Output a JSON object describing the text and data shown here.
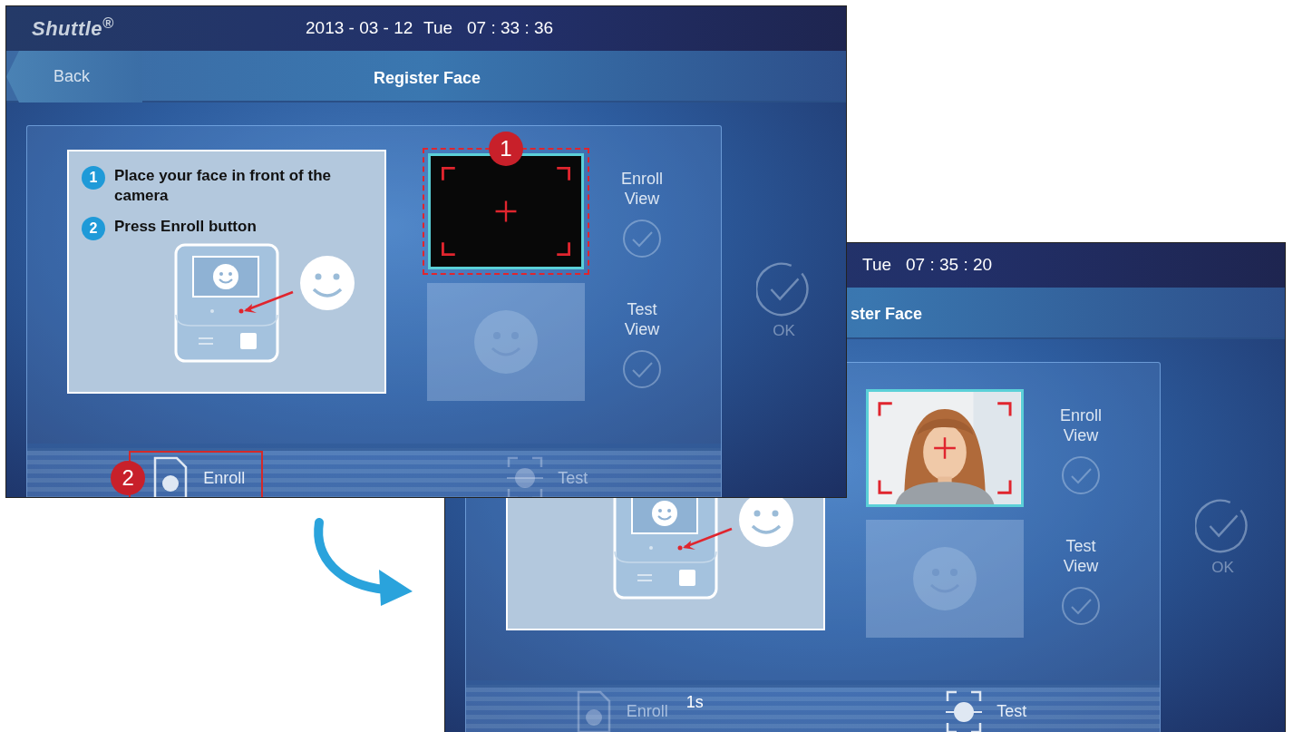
{
  "screens": [
    {
      "logo": "Shuttle$^{®}$",
      "status": {
        "date": "2013 - 03 - 12",
        "day": "Tue",
        "time": "07 : 33 : 36"
      },
      "back": "Back",
      "title": "Register Face",
      "steps": [
        {
          "number": "1",
          "text": "Place your face in front of the camera"
        },
        {
          "number": "2",
          "text": "Press Enroll button"
        }
      ],
      "views": [
        {
          "label": "Enroll View",
          "kind": "camera",
          "callout": "1"
        },
        {
          "label": "Test View",
          "kind": "placeholder"
        }
      ],
      "ok": "OK",
      "actions": [
        {
          "label": "Enroll",
          "kind": "enroll",
          "disabled": false,
          "callout": "2"
        },
        {
          "label": "Test",
          "kind": "test",
          "disabled": true
        }
      ]
    },
    {
      "status": {
        "day": "Tue",
        "time": "07 : 35 : 20"
      },
      "title": "ster Face",
      "views": [
        {
          "label": "Enroll View"
        },
        {
          "label": "Test View",
          "kind": "placeholder"
        }
      ],
      "ok": "OK",
      "actions": [
        {
          "label": "Enroll",
          "kind": "enroll",
          "disabled": true,
          "countdown": "1s"
        },
        {
          "label": "Test",
          "kind": "test",
          "disabled": false
        }
      ]
    }
  ]
}
